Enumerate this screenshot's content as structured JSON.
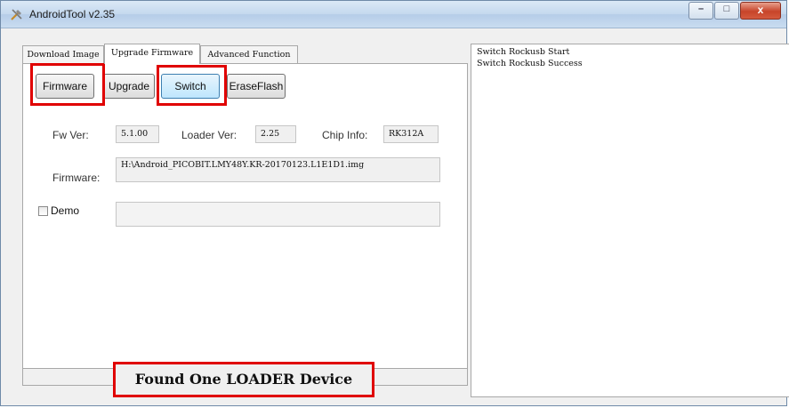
{
  "window": {
    "title": "AndroidTool v2.35",
    "minimize_glyph": "–",
    "maximize_glyph": "□",
    "close_glyph": "x"
  },
  "tabs": [
    {
      "label": "Download Image",
      "active": false
    },
    {
      "label": "Upgrade Firmware",
      "active": true
    },
    {
      "label": "Advanced Function",
      "active": false
    }
  ],
  "toolbar": {
    "firmware_label": "Firmware",
    "upgrade_label": "Upgrade",
    "switch_label": "Switch",
    "eraseflash_label": "EraseFlash"
  },
  "info": {
    "fw_ver_label": "Fw Ver:",
    "fw_ver_value": "5.1.00",
    "loader_ver_label": "Loader Ver:",
    "loader_ver_value": "2.25",
    "chip_info_label": "Chip Info:",
    "chip_info_value": "RK312A",
    "firmware_label": "Firmware:",
    "firmware_path": "H:\\Android_PICOBIT.LMY48Y.KR-20170123.L1E1D1.img",
    "demo_label": "Demo",
    "demo_checked": false,
    "demo_value": ""
  },
  "status": {
    "message": "Found One LOADER Device"
  },
  "log": {
    "lines": [
      "Switch Rockusb Start",
      "Switch Rockusb Success"
    ]
  },
  "colors": {
    "highlight": "#e00000",
    "hot_button": "#bee6fd"
  }
}
